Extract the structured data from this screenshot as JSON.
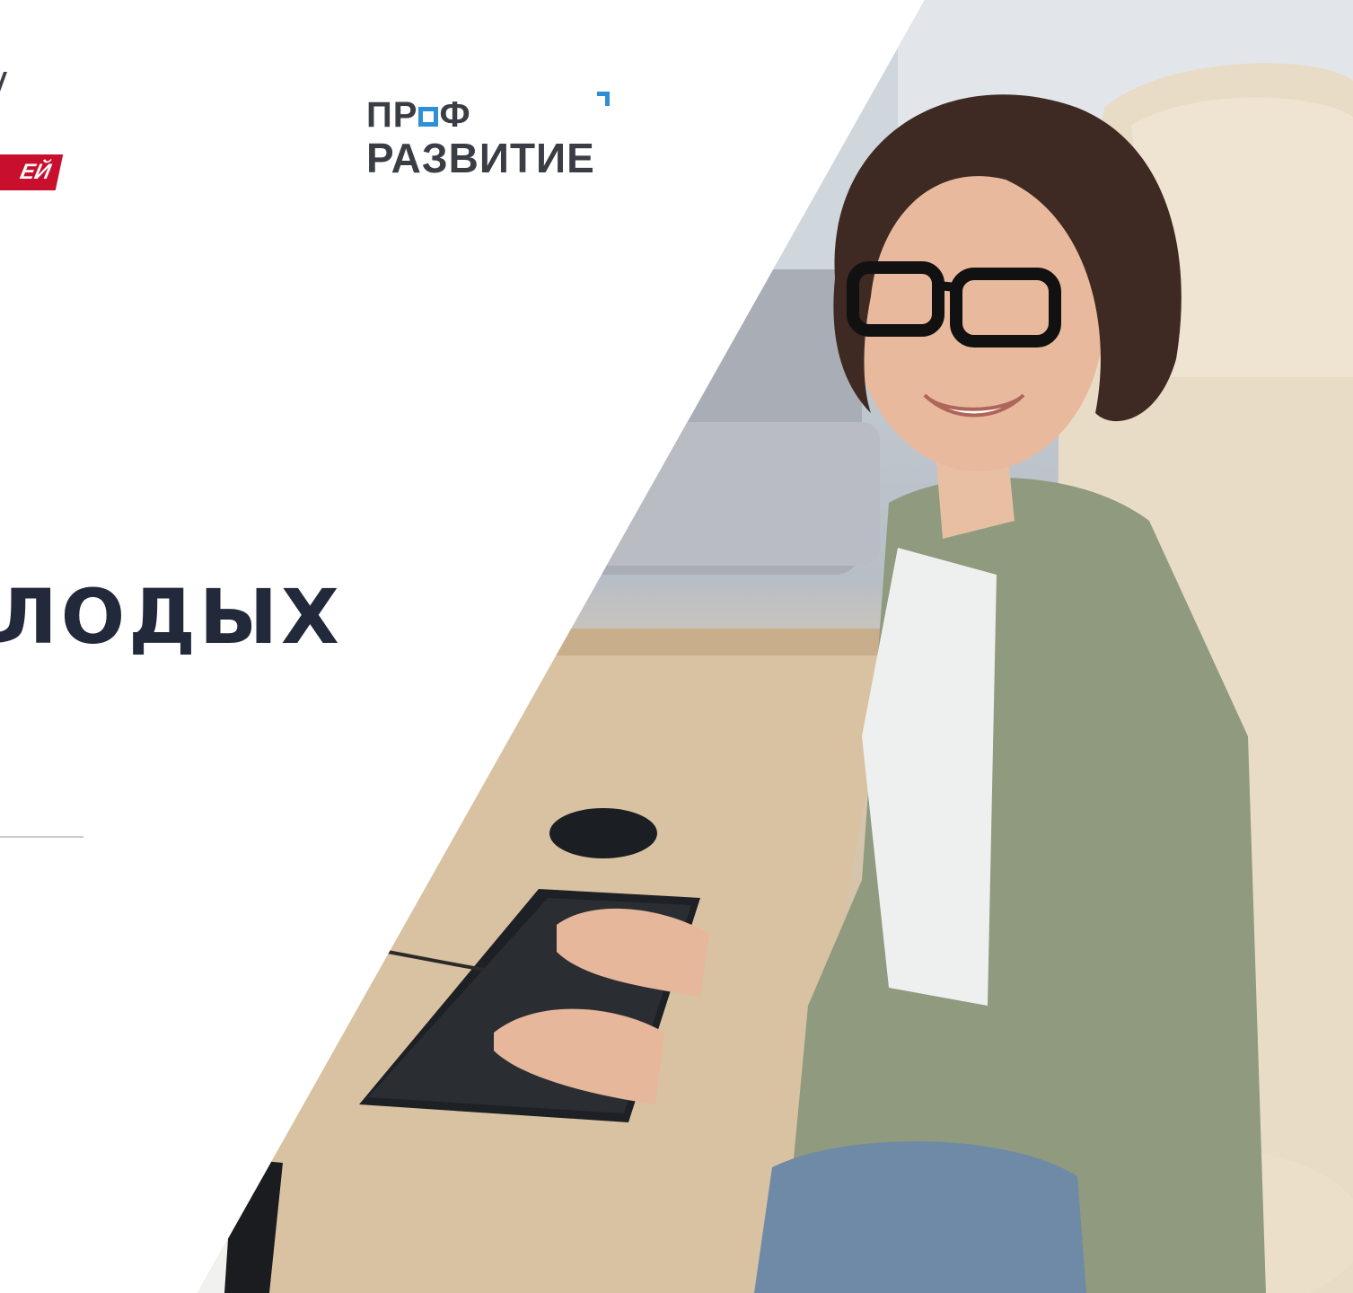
{
  "logos": {
    "left_ribbon_text": "ЕЙ",
    "prof_line1": "ПР",
    "prof_line1_end": "Ф",
    "prof_line2": "РАЗВИТИЕ",
    "prof_accent_color": "#2f8fd6",
    "ribbon_color": "#c8102e"
  },
  "title": "ЛОДЫХ",
  "photo": {
    "subject": "woman-at-computer-photo"
  }
}
